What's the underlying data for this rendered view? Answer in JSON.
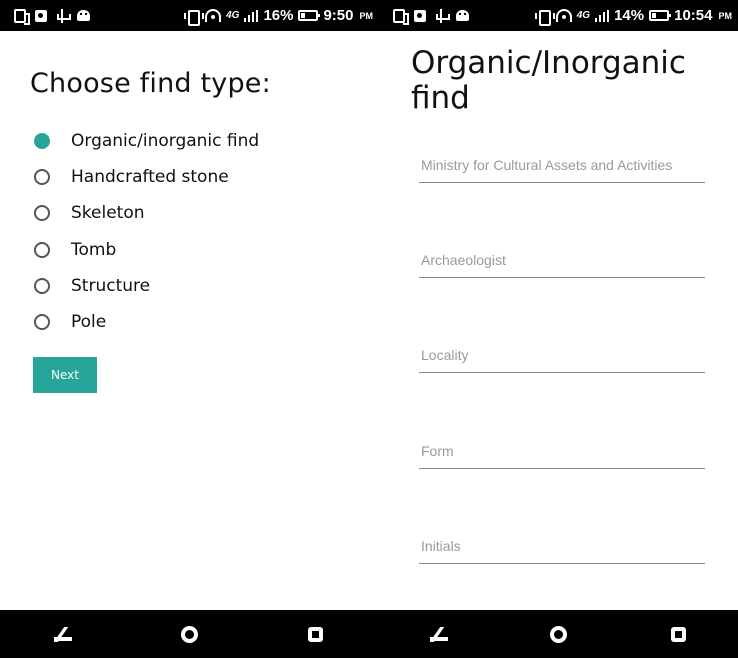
{
  "left_screen": {
    "status": {
      "battery_percent": "16%",
      "time": "9:50",
      "am_pm": "PM",
      "network": "4G"
    },
    "title": "Choose find type:",
    "options": [
      {
        "label": "Organic/inorganic find",
        "selected": true
      },
      {
        "label": "Handcrafted stone",
        "selected": false
      },
      {
        "label": "Skeleton",
        "selected": false
      },
      {
        "label": "Tomb",
        "selected": false
      },
      {
        "label": "Structure",
        "selected": false
      },
      {
        "label": "Pole",
        "selected": false
      }
    ],
    "next_label": "Next"
  },
  "right_screen": {
    "status": {
      "battery_percent": "14%",
      "time": "10:54",
      "am_pm": "PM",
      "network": "4G"
    },
    "title": "Organic/Inorganic find",
    "fields": [
      {
        "placeholder": "Ministry for Cultural Assets and Activities",
        "value": ""
      },
      {
        "placeholder": "Archaeologist",
        "value": ""
      },
      {
        "placeholder": "Locality",
        "value": ""
      },
      {
        "placeholder": "Form",
        "value": ""
      },
      {
        "placeholder": "Initials",
        "value": ""
      }
    ]
  },
  "colors": {
    "accent": "#26a69a",
    "bar": "#000000",
    "field_line": "#8a8a8a",
    "placeholder": "#9a9a9a"
  },
  "icons": {
    "status_left": [
      "phone-icon",
      "outlook-icon",
      "usb-icon",
      "android-icon"
    ],
    "status_right": [
      "vibrate-icon",
      "wifi-icon",
      "signal-icon",
      "battery-icon"
    ],
    "navigation": [
      "back-icon",
      "home-icon",
      "recents-icon"
    ]
  }
}
